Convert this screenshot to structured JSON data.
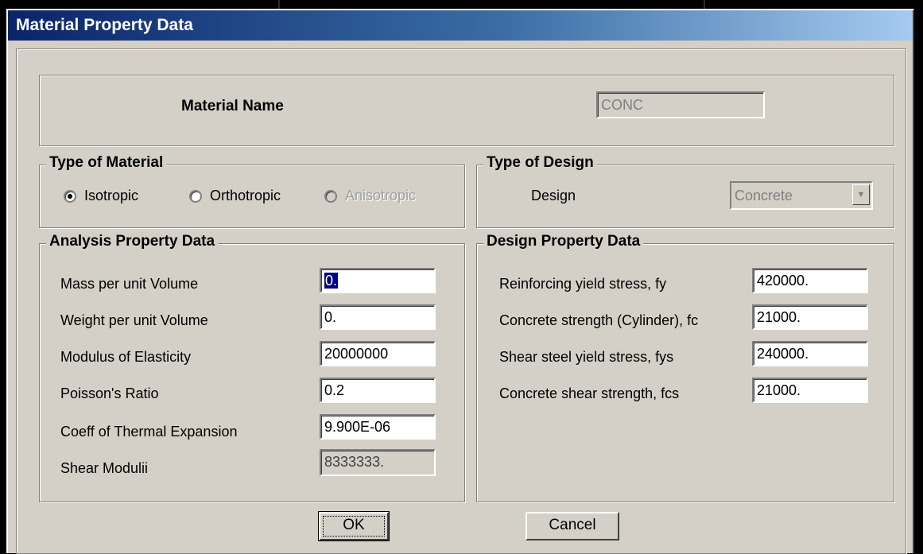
{
  "window": {
    "title": "Material Property Data"
  },
  "material_name": {
    "label": "Material Name",
    "value": "CONC"
  },
  "type_of_material": {
    "legend": "Type of Material",
    "options": [
      {
        "label": "Isotropic",
        "checked": true,
        "enabled": true
      },
      {
        "label": "Orthotropic",
        "checked": false,
        "enabled": true
      },
      {
        "label": "Anisotropic",
        "checked": false,
        "enabled": false
      }
    ]
  },
  "type_of_design": {
    "legend": "Type of Design",
    "design_label": "Design",
    "design_value": "Concrete"
  },
  "analysis": {
    "legend": "Analysis Property Data",
    "rows": [
      {
        "label": "Mass per unit Volume",
        "value": "0."
      },
      {
        "label": "Weight per unit Volume",
        "value": "0."
      },
      {
        "label": "Modulus of Elasticity",
        "value": "20000000"
      },
      {
        "label": "Poisson's Ratio",
        "value": "0.2"
      },
      {
        "label": "Coeff of Thermal Expansion",
        "value": "9.900E-06"
      },
      {
        "label": "Shear Modulii",
        "value": "8333333."
      }
    ]
  },
  "design_props": {
    "legend": "Design Property Data",
    "rows": [
      {
        "label": "Reinforcing yield stress, fy",
        "value": "420000."
      },
      {
        "label": "Concrete strength (Cylinder), fc",
        "value": "21000."
      },
      {
        "label": "Shear steel yield stress, fys",
        "value": "240000."
      },
      {
        "label": "Concrete shear strength, fcs",
        "value": "21000."
      }
    ]
  },
  "buttons": {
    "ok": "OK",
    "cancel": "Cancel"
  }
}
